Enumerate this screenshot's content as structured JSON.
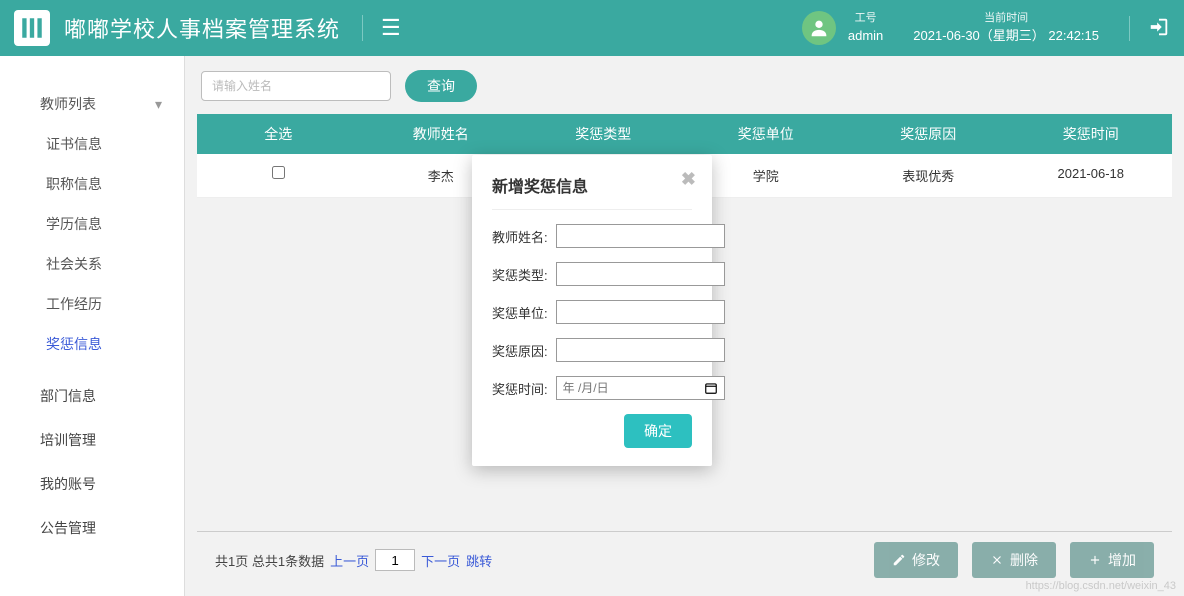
{
  "app": {
    "title": "嘟嘟学校人事档案管理系统"
  },
  "user": {
    "label": "工号",
    "value": "admin"
  },
  "clock": {
    "label": "当前时间",
    "value": "2021-06-30（星期三） 22:42:15"
  },
  "sidebar": {
    "teacher_header": "教师列表",
    "subs": [
      {
        "label": "证书信息"
      },
      {
        "label": "职称信息"
      },
      {
        "label": "学历信息"
      },
      {
        "label": "社会关系"
      },
      {
        "label": "工作经历"
      },
      {
        "label": "奖惩信息"
      }
    ],
    "tops": [
      {
        "label": "部门信息"
      },
      {
        "label": "培训管理"
      },
      {
        "label": "我的账号"
      },
      {
        "label": "公告管理"
      }
    ]
  },
  "search": {
    "placeholder": "请输入姓名",
    "button": "查询"
  },
  "table": {
    "headers": [
      "全选",
      "教师姓名",
      "奖惩类型",
      "奖惩单位",
      "奖惩原因",
      "奖惩时间"
    ],
    "rows": [
      {
        "name": "李杰",
        "type": "",
        "unit": "学院",
        "reason": "表现优秀",
        "time": "2021-06-18"
      }
    ]
  },
  "pager": {
    "summary": "共1页 总共1条数据",
    "prev": "上一页",
    "next": "下一页",
    "jump": "跳转",
    "page_input": "1"
  },
  "actions": {
    "edit": "修改",
    "delete": "删除",
    "add": "增加"
  },
  "modal": {
    "title": "新增奖惩信息",
    "fields": {
      "name": "教师姓名:",
      "type": "奖惩类型:",
      "unit": "奖惩单位:",
      "reason": "奖惩原因:",
      "time": "奖惩时间:"
    },
    "date_placeholder": "年 /月/日",
    "ok": "确定"
  },
  "watermark": "https://blog.csdn.net/weixin_43"
}
